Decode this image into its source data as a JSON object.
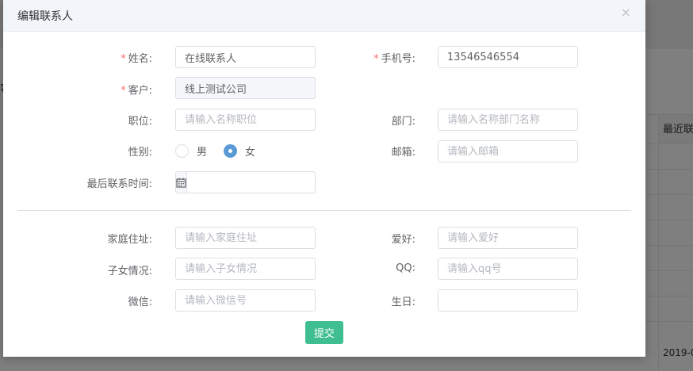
{
  "background": {
    "side_fragment": "客",
    "column_header": "最近联",
    "cell_date": "2019-0"
  },
  "dialog": {
    "title": "编辑联系人",
    "close_symbol": "×"
  },
  "form": {
    "name": {
      "label": "姓名:",
      "value": "在线联系人",
      "required": true
    },
    "phone": {
      "label": "手机号:",
      "value": "13546546554",
      "required": true
    },
    "customer": {
      "label": "客户:",
      "value": "线上测试公司",
      "required": true
    },
    "position": {
      "label": "职位:",
      "placeholder": "请输入名称职位"
    },
    "department": {
      "label": "部门:",
      "placeholder": "请输入名称部门名称"
    },
    "gender": {
      "label": "性别:",
      "options": [
        "男",
        "女"
      ],
      "selected": "女"
    },
    "email": {
      "label": "邮箱:",
      "placeholder": "请输入邮箱"
    },
    "last_contact": {
      "label": "最后联系时间:",
      "value": ""
    },
    "address": {
      "label": "家庭住址:",
      "placeholder": "请输入家庭住址"
    },
    "hobby": {
      "label": "爱好:",
      "placeholder": "请输入爱好"
    },
    "children": {
      "label": "子女情况:",
      "placeholder": "请输入子女情况"
    },
    "qq": {
      "label": "QQ:",
      "placeholder": "请输入qq号"
    },
    "wechat": {
      "label": "微信:",
      "placeholder": "请输入微信号"
    },
    "birthday": {
      "label": "生日:",
      "value": ""
    }
  },
  "submit_label": "提交",
  "colors": {
    "required": "#f56c6c",
    "radio_checked": "#5b9bd5",
    "submit": "#3fbf8f"
  }
}
